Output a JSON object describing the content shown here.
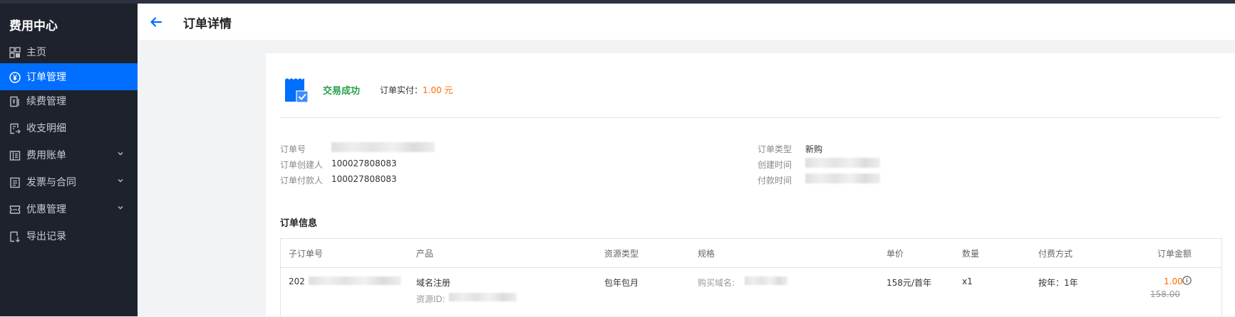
{
  "sidebar": {
    "title": "费用中心",
    "items": [
      {
        "label": "主页",
        "icon": "dashboard-icon",
        "active": false
      },
      {
        "label": "订单管理",
        "icon": "yuan-circle-icon",
        "active": true
      },
      {
        "label": "续费管理",
        "icon": "renew-icon",
        "active": false
      },
      {
        "label": "收支明细",
        "icon": "ledger-icon",
        "active": false
      },
      {
        "label": "费用账单",
        "icon": "bill-icon",
        "active": false,
        "expandable": true
      },
      {
        "label": "发票与合同",
        "icon": "invoice-icon",
        "active": false,
        "expandable": true
      },
      {
        "label": "优惠管理",
        "icon": "coupon-icon",
        "active": false,
        "expandable": true
      },
      {
        "label": "导出记录",
        "icon": "export-icon",
        "active": false
      }
    ]
  },
  "header": {
    "title": "订单详情",
    "back_icon": "back-arrow-icon"
  },
  "status": {
    "text": "交易成功",
    "paid_label": "订单实付：",
    "paid_value": "1.00 元",
    "icon": "receipt-check-icon"
  },
  "order_info": {
    "order_no_label": "订单号",
    "creator_label": "订单创建人",
    "creator_value": "100027808083",
    "payer_label": "订单付款人",
    "payer_value": "100027808083",
    "type_label": "订单类型",
    "type_value": "新购",
    "created_time_label": "创建时间",
    "paid_time_label": "付款时间"
  },
  "section": {
    "title": "订单信息"
  },
  "table": {
    "headers": [
      "子订单号",
      "产品",
      "资源类型",
      "规格",
      "单价",
      "数量",
      "付费方式",
      "订单金额"
    ],
    "row": {
      "sub_order_prefix": "202",
      "product": "域名注册",
      "resource_id_label": "资源ID:",
      "resource_type": "包年包月",
      "spec_label": "购买域名:",
      "unit_price": "158元/首年",
      "quantity": "x1",
      "payment": "按年：1年",
      "amount": "1.00",
      "original_amount": "158.00"
    }
  },
  "colors": {
    "accent": "#006eff",
    "success": "#29a14b",
    "price": "#ff6a00",
    "sidebar_bg": "#1e222d"
  }
}
